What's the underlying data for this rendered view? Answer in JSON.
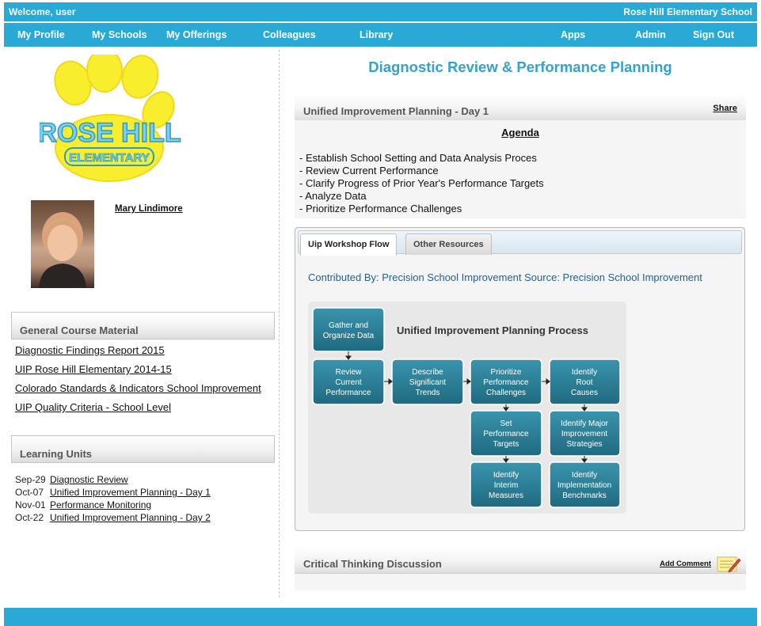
{
  "topbar": {
    "welcome": "Welcome, user",
    "school": "Rose Hill Elementary School"
  },
  "nav": {
    "my_profile": "My Profile",
    "my_schools": "My Schools",
    "my_offerings": "My Offerings",
    "colleagues": "Colleagues",
    "library": "Library",
    "apps": "Apps",
    "admin": "Admin",
    "sign_out": "Sign Out"
  },
  "logo": {
    "line1": "ROSE HILL",
    "line2": "ELEMENTARY",
    "colors": {
      "paw": "#f8ee2d",
      "text": "#7fd0e6",
      "outline": "#2a9bc8"
    }
  },
  "profile": {
    "name": "Mary Lindimore"
  },
  "general_material": {
    "header": "General Course Material",
    "links": [
      "Diagnostic Findings Report 2015",
      "UIP Rose Hill Elementary 2014-15",
      "Colorado Standards & Indicators School Improvement",
      "UIP Quality Criteria - School Level"
    ]
  },
  "learning_units": {
    "header": "Learning Units",
    "items": [
      {
        "date": "Sep-29",
        "title": "Diagnostic Review"
      },
      {
        "date": "Oct-07",
        "title": "Unified Improvement Planning - Day 1"
      },
      {
        "date": "Nov-01",
        "title": "Performance Monitoring"
      },
      {
        "date": "Oct-22",
        "title": "Unified Improvement Planning - Day 2"
      }
    ]
  },
  "main": {
    "page_title": "Diagnostic Review & Performance Planning",
    "panel1": {
      "title": "Unified Improvement Planning - Day 1",
      "share": "Share",
      "agenda_title": "Agenda",
      "agenda_items": [
        "-  Establish School Setting and Data Analysis Proces",
        "-  Review Current Performance",
        "-  Clarify Progress of Prior Year's Performance Targets",
        "-  Analyze Data",
        "-  Prioritize Performance Challenges"
      ]
    },
    "tabs": [
      {
        "label": "Uip Workshop Flow",
        "active": true
      },
      {
        "label": "Other Resources",
        "active": false
      }
    ],
    "contributed": "Contributed By:  Precision School Improvement  Source: Precision School Improvement",
    "diagram": {
      "title": "Unified Improvement Planning Process",
      "boxes": {
        "gather": [
          "Gather and",
          "Organize Data"
        ],
        "review": [
          "Review",
          "Current",
          "Performance"
        ],
        "describe": [
          "Describe",
          "Significant",
          "Trends"
        ],
        "prioritize": [
          "Prioritize",
          "Performance",
          "Challenges"
        ],
        "root": [
          "Identify",
          "Root",
          "Causes"
        ],
        "targets": [
          "Set",
          "Performance",
          "Targets"
        ],
        "strategies": [
          "Identify Major",
          "Improvement",
          "Strategies"
        ],
        "interim": [
          "Identify",
          "Interim",
          "Measures"
        ],
        "benchmarks": [
          "Identify",
          "Implementation",
          "Benchmarks"
        ]
      }
    },
    "panel3": {
      "title": "Critical Thinking Discussion",
      "add_comment": "Add Comment"
    }
  },
  "colors": {
    "brand": "#29a9d6",
    "title": "#31a3cc",
    "diagram_box": "#2b7f96"
  }
}
